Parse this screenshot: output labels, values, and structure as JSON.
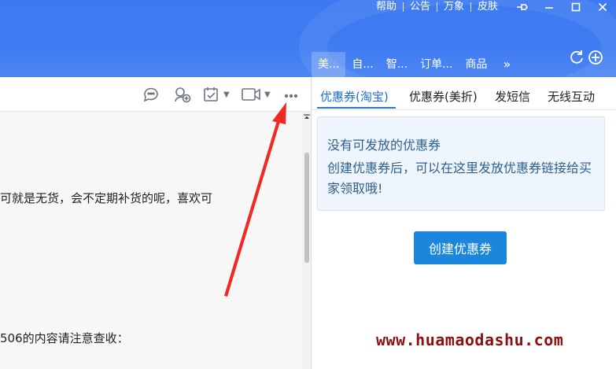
{
  "top_menu": {
    "items": [
      "帮助",
      "公告",
      "万象",
      "皮肤"
    ]
  },
  "window_controls": [
    "pin-icon",
    "minimize-icon",
    "maximize-icon",
    "close-icon"
  ],
  "header_tabs": {
    "items": [
      "美...",
      "自...",
      "智...",
      "订单...",
      "商品"
    ],
    "active_index": 0,
    "more": "»"
  },
  "chat": {
    "messages": [
      "可就是无货，会不定期补货的呢，喜欢可",
      "506的内容请注意查收："
    ]
  },
  "coupon_tabs": {
    "items": [
      "优惠券(淘宝)",
      "优惠券(美折)",
      "发短信",
      "无线互动"
    ],
    "active_index": 0
  },
  "notice": {
    "title": "没有可发放的优惠券",
    "body": "创建优惠券后，可以在这里发放优惠券链接给买家领取哦!"
  },
  "create_button": {
    "label": "创建优惠券"
  },
  "watermark": "www.huamaodashu.com",
  "colors": {
    "header_blue": "#3f7cf2",
    "accent_blue": "#1a87dc",
    "watermark": "#8b1111",
    "annotation_arrow": "#f02a22"
  }
}
